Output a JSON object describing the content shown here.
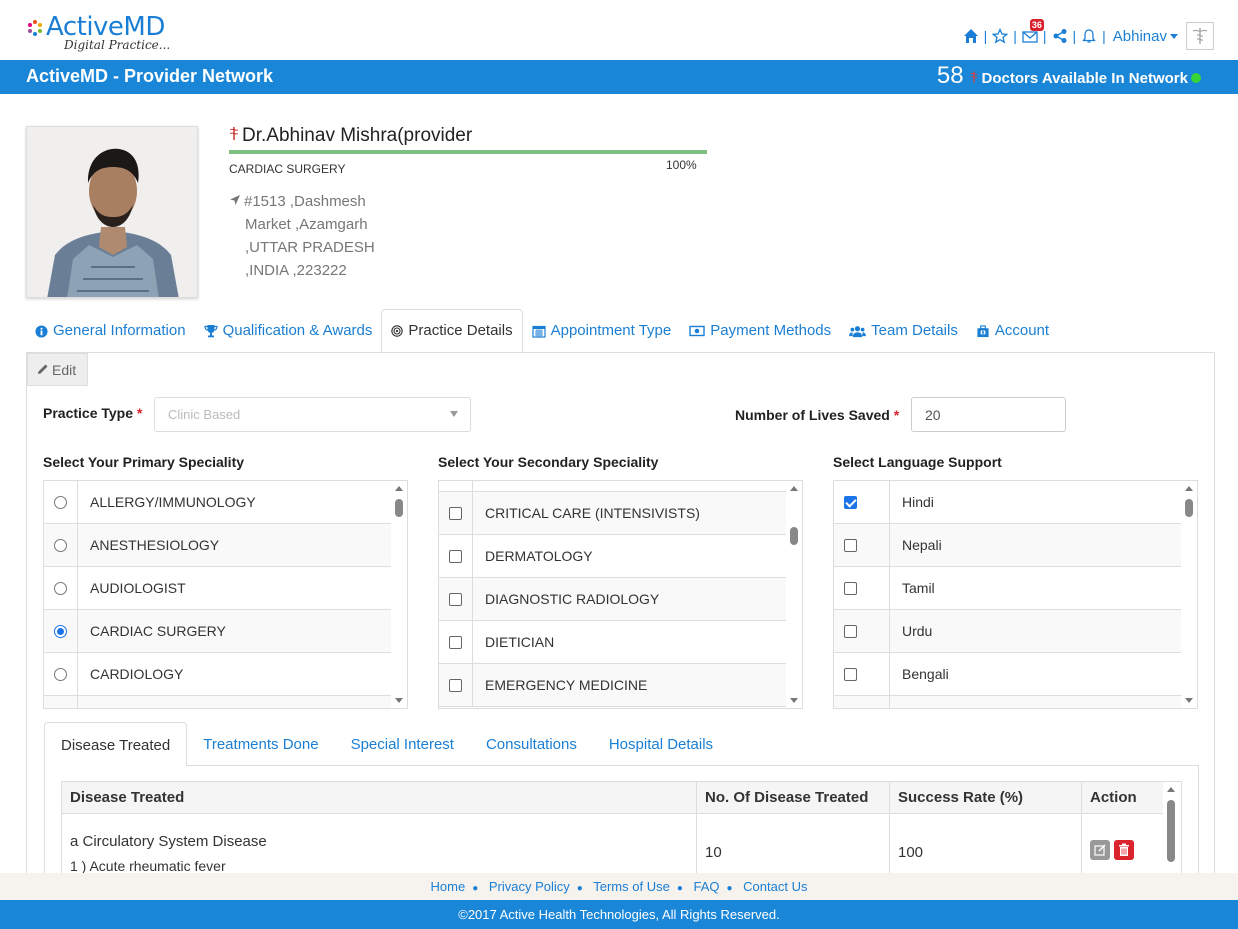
{
  "header": {
    "logo_text": "ActiveMD",
    "logo_sub": "Digital Practice...",
    "mail_badge": "36",
    "user_name": "Abhinav"
  },
  "bluebar": {
    "title": "ActiveMD - Provider Network",
    "doctor_count": "58",
    "doctor_text": "Doctors Available In Network"
  },
  "profile": {
    "name": "Dr.Abhinav Mishra(provider",
    "specialty": "CARDIAC SURGERY",
    "completion": "100%",
    "completion_value": 100,
    "address": [
      "#1513 ,Dashmesh",
      "Market ,Azamgarh",
      ",UTTAR PRADESH",
      ",INDIA ,223222"
    ]
  },
  "tabs": [
    {
      "label": "General Information",
      "icon": "info-icon"
    },
    {
      "label": "Qualification & Awards",
      "icon": "trophy-icon"
    },
    {
      "label": "Practice Details",
      "icon": "bullseye-icon",
      "active": true
    },
    {
      "label": "Appointment Type",
      "icon": "calendar-icon"
    },
    {
      "label": "Payment Methods",
      "icon": "money-icon"
    },
    {
      "label": "Team Details",
      "icon": "users-icon"
    },
    {
      "label": "Account",
      "icon": "briefcase-icon"
    }
  ],
  "form": {
    "edit_label": "Edit",
    "practice_type_label": "Practice Type",
    "practice_type_value": "Clinic Based",
    "lives_saved_label": "Number of Lives Saved",
    "lives_saved_value": "20",
    "primary_label": "Select Your Primary Speciality",
    "secondary_label": "Select Your Secondary Speciality",
    "language_label": "Select Language Support"
  },
  "primary_specialities": [
    {
      "label": "ALLERGY/IMMUNOLOGY",
      "checked": false
    },
    {
      "label": "ANESTHESIOLOGY",
      "checked": false
    },
    {
      "label": "AUDIOLOGIST",
      "checked": false
    },
    {
      "label": "CARDIAC SURGERY",
      "checked": true
    },
    {
      "label": "CARDIOLOGY",
      "checked": false
    }
  ],
  "secondary_specialities": [
    {
      "label": "CRITICAL CARE (INTENSIVISTS)",
      "checked": false
    },
    {
      "label": "DERMATOLOGY",
      "checked": false
    },
    {
      "label": "DIAGNOSTIC RADIOLOGY",
      "checked": false
    },
    {
      "label": "DIETICIAN",
      "checked": false
    },
    {
      "label": "EMERGENCY MEDICINE",
      "checked": false
    }
  ],
  "languages": [
    {
      "label": "Hindi",
      "checked": true
    },
    {
      "label": "Nepali",
      "checked": false
    },
    {
      "label": "Tamil",
      "checked": false
    },
    {
      "label": "Urdu",
      "checked": false
    },
    {
      "label": "Bengali",
      "checked": false
    }
  ],
  "subtabs": [
    {
      "label": "Disease Treated",
      "active": true
    },
    {
      "label": "Treatments Done"
    },
    {
      "label": "Special Interest"
    },
    {
      "label": "Consultations"
    },
    {
      "label": "Hospital Details"
    }
  ],
  "table": {
    "headers": [
      "Disease Treated",
      "No. Of Disease Treated",
      "Success Rate (%)",
      "Action"
    ],
    "rows": [
      {
        "disease": "a Circulatory System Disease",
        "sub": "1 ) Acute rheumatic fever",
        "count": "10",
        "rate": "100"
      }
    ]
  },
  "footer": {
    "links": [
      "Home",
      "Privacy Policy",
      "Terms of Use",
      "FAQ",
      "Contact Us"
    ],
    "copyright": "©2017 Active Health Technologies, All Rights Reserved."
  },
  "colors": {
    "brand_blue": "#1a86d8",
    "link_blue": "#1a7fd4",
    "danger": "#d9232d",
    "online": "#37d437"
  }
}
